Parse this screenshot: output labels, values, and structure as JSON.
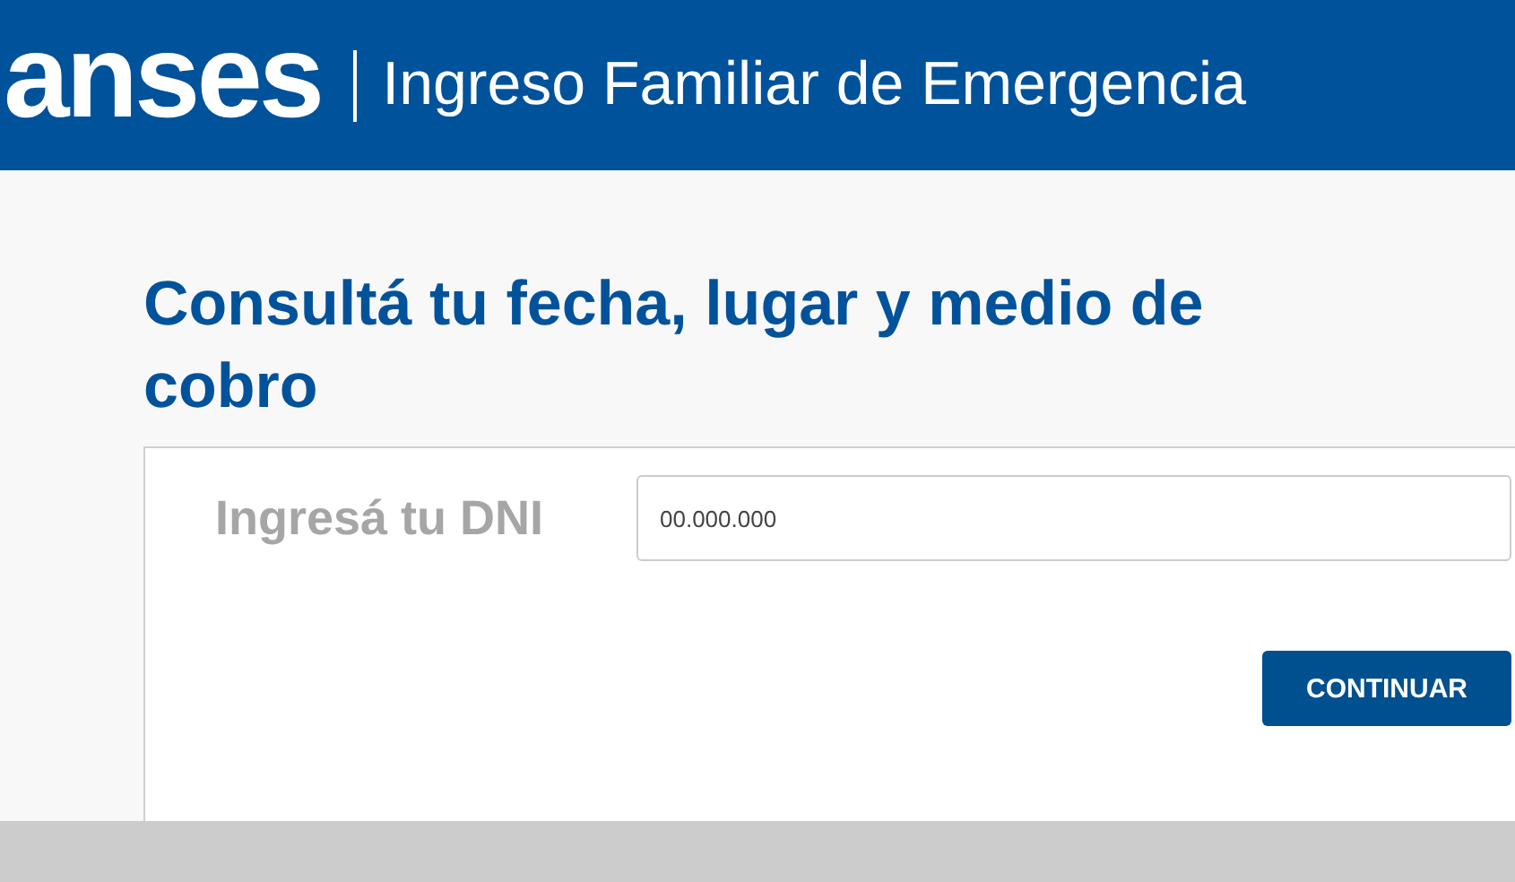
{
  "header": {
    "logo": "anses",
    "title": "Ingreso Familiar de Emergencia"
  },
  "heading": "Consultá tu fecha, lugar y medio de cobro",
  "form": {
    "label": "Ingresá tu DNI",
    "dni_field": {
      "placeholder": "00.000.000"
    },
    "button": "CONTINUAR"
  }
}
